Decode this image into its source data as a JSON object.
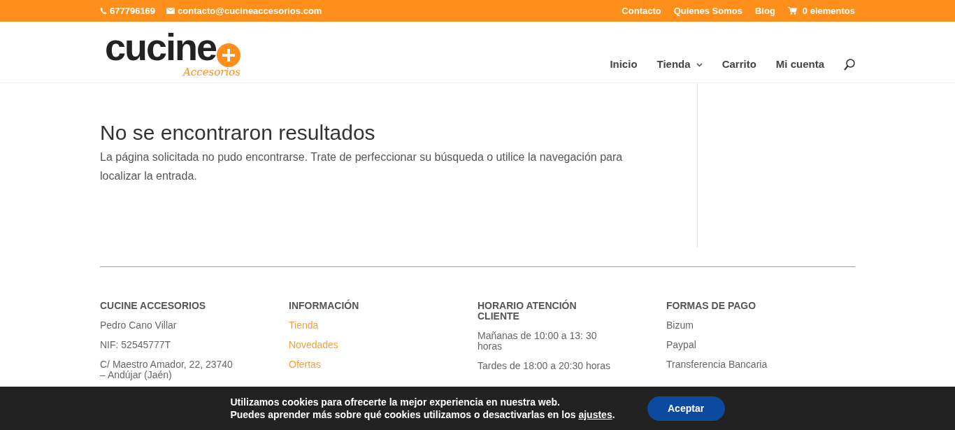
{
  "top_bar": {
    "phone": "677796169",
    "email": "contacto@cucineaccesorios.com",
    "links": [
      "Contacto",
      "Quienes Somos",
      "Blog"
    ],
    "cart": "0 elementos"
  },
  "header": {
    "logo": {
      "word": "cucine",
      "sub": "Accesorios"
    },
    "nav": [
      {
        "label": "Inicio",
        "dropdown": false
      },
      {
        "label": "Tienda",
        "dropdown": true
      },
      {
        "label": "Carrito",
        "dropdown": false
      },
      {
        "label": "Mi cuenta",
        "dropdown": false
      }
    ]
  },
  "main": {
    "title": "No se encontraron resultados",
    "message": "La página solicitada no pudo encontrarse. Trate de perfeccionar su búsqueda o utilice la navegación para localizar la entrada."
  },
  "footer": {
    "columns": [
      {
        "title": "CUCINE ACCESORIOS",
        "items": [
          {
            "text": "Pedro Cano Villar",
            "link": false
          },
          {
            "text": "NIF: 52545777T",
            "link": false
          },
          {
            "text": "C/ Maestro Amador, 22, 23740 – Andújar (Jaén)",
            "link": false
          }
        ]
      },
      {
        "title": "INFORMACIÓN",
        "items": [
          {
            "text": "Tienda",
            "link": true
          },
          {
            "text": "Novedades",
            "link": true
          },
          {
            "text": "Ofertas",
            "link": true
          }
        ]
      },
      {
        "title": "HORARIO ATENCIÓN CLIENTE",
        "items": [
          {
            "text": "Mañanas de 10:00 a 13: 30 horas",
            "link": false
          },
          {
            "text": "Tardes de 18:00 a 20:30 horas",
            "link": false
          }
        ]
      },
      {
        "title": "FORMAS DE PAGO",
        "items": [
          {
            "text": "Bizum",
            "link": false
          },
          {
            "text": "Paypal",
            "link": false
          },
          {
            "text": "Transferencia Bancaria",
            "link": false
          }
        ]
      }
    ]
  },
  "cookie_bar": {
    "line1": "Utilizamos cookies para ofrecerte la mejor experiencia en nuestra web.",
    "line2": "Puedes aprender más sobre qué cookies utilizamos o desactivarlas en los",
    "link": "ajustes",
    "end": ".",
    "button": "Aceptar"
  }
}
